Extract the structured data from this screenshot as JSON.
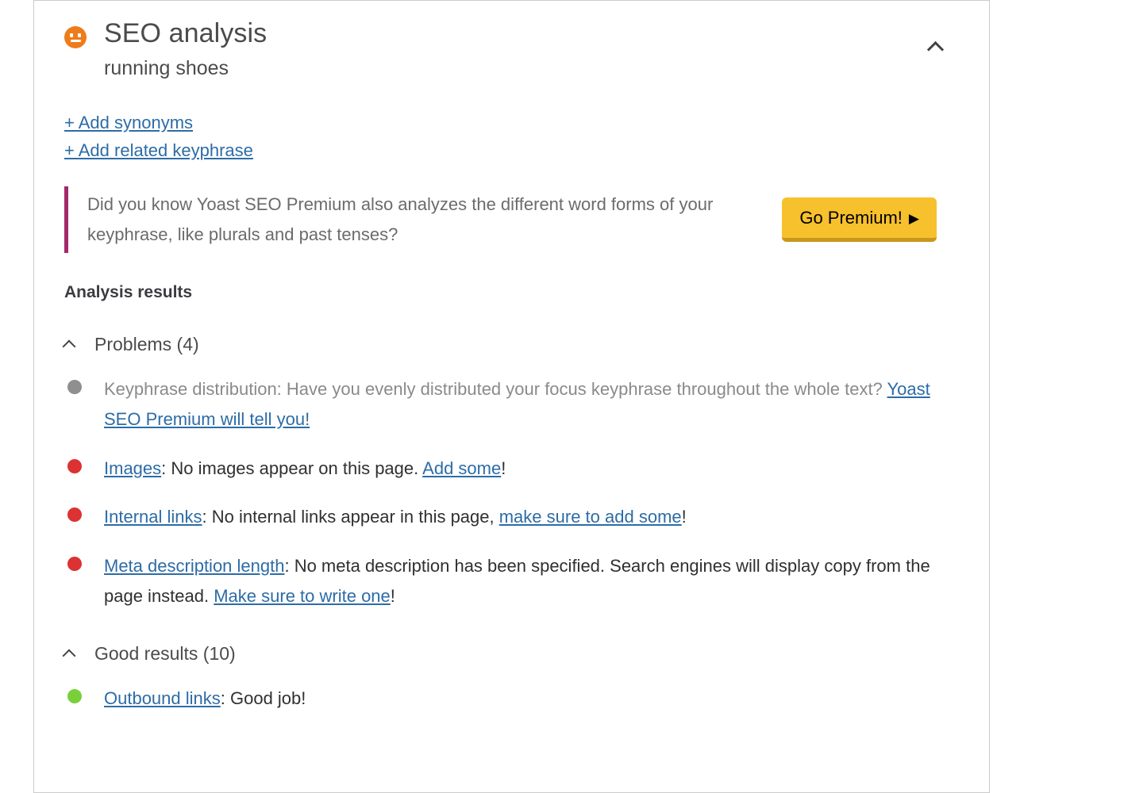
{
  "panel": {
    "score_icon": "neutral-face-icon",
    "score_color": "#ee7c1b",
    "title": "SEO analysis",
    "subtitle": "running shoes",
    "collapse_icon": "chevron-up-icon"
  },
  "add_links": [
    {
      "label": "+ Add synonyms",
      "name": "add-synonyms-link"
    },
    {
      "label": "+ Add related keyphrase",
      "name": "add-related-keyphrase-link"
    }
  ],
  "premium_callout": {
    "accent_color": "#a4286a",
    "text": "Did you know Yoast SEO Premium also analyzes the different word forms of your keyphrase, like plurals and past tenses?",
    "button_label": "Go Premium!",
    "button_arrow": "▶",
    "button_color": "#f7c02d"
  },
  "analysis": {
    "heading": "Analysis results",
    "groups": [
      {
        "title": "Problems (4)",
        "toggle_icon": "chevron-up-icon",
        "items": [
          {
            "bullet": "gray",
            "muted": true,
            "parts": [
              {
                "type": "text",
                "value": "Keyphrase distribution: Have you evenly distributed your focus keyphrase throughout the whole text? "
              },
              {
                "type": "link",
                "value": "Yoast SEO Premium will tell you!"
              }
            ]
          },
          {
            "bullet": "red",
            "muted": false,
            "parts": [
              {
                "type": "link",
                "value": "Images"
              },
              {
                "type": "text",
                "value": ": No images appear on this page. "
              },
              {
                "type": "link",
                "value": "Add some"
              },
              {
                "type": "text",
                "value": "!"
              }
            ]
          },
          {
            "bullet": "red",
            "muted": false,
            "parts": [
              {
                "type": "link",
                "value": "Internal links"
              },
              {
                "type": "text",
                "value": ": No internal links appear in this page, "
              },
              {
                "type": "link",
                "value": "make sure to add some"
              },
              {
                "type": "text",
                "value": "!"
              }
            ]
          },
          {
            "bullet": "red",
            "muted": false,
            "parts": [
              {
                "type": "link",
                "value": "Meta description length"
              },
              {
                "type": "text",
                "value": ": No meta description has been specified. Search engines will display copy from the page instead. "
              },
              {
                "type": "link",
                "value": "Make sure to write one"
              },
              {
                "type": "text",
                "value": "!"
              }
            ]
          }
        ]
      },
      {
        "title": "Good results (10)",
        "toggle_icon": "chevron-up-icon",
        "items": [
          {
            "bullet": "green",
            "muted": false,
            "parts": [
              {
                "type": "link",
                "value": "Outbound links"
              },
              {
                "type": "text",
                "value": ": Good job!"
              }
            ]
          }
        ]
      }
    ]
  }
}
